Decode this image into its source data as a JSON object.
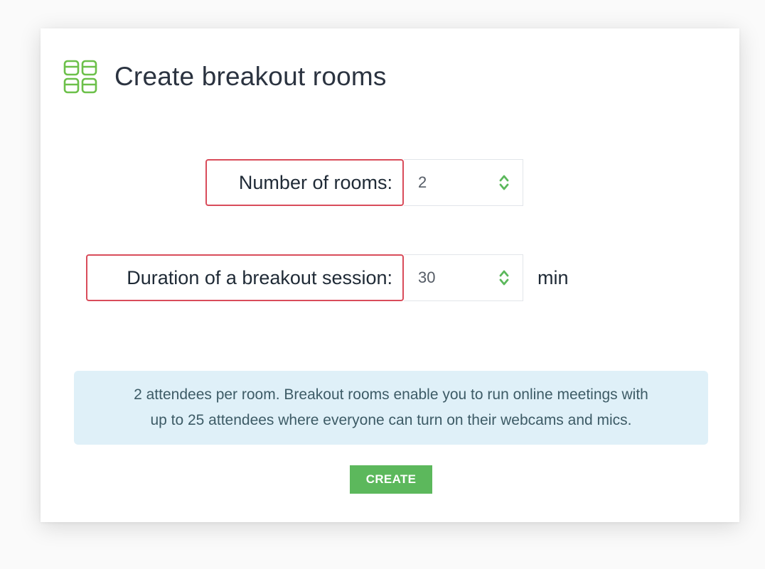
{
  "dialog": {
    "title": "Create breakout rooms",
    "icon": "breakout-rooms-icon"
  },
  "rooms": {
    "label": "Number of rooms:",
    "value": "2"
  },
  "duration": {
    "label": "Duration of a breakout session:",
    "value": "30",
    "unit": "min"
  },
  "info": {
    "line1": "2 attendees per room. Breakout rooms enable you to run online meetings with",
    "line2": "up to 25 attendees where everyone can turn on their webcams and mics."
  },
  "actions": {
    "create_label": "CREATE"
  },
  "colors": {
    "accent_green": "#5cb85c",
    "highlight_red": "#d94c5a",
    "info_bg": "#dff0f8",
    "title_text": "#2b3340"
  }
}
